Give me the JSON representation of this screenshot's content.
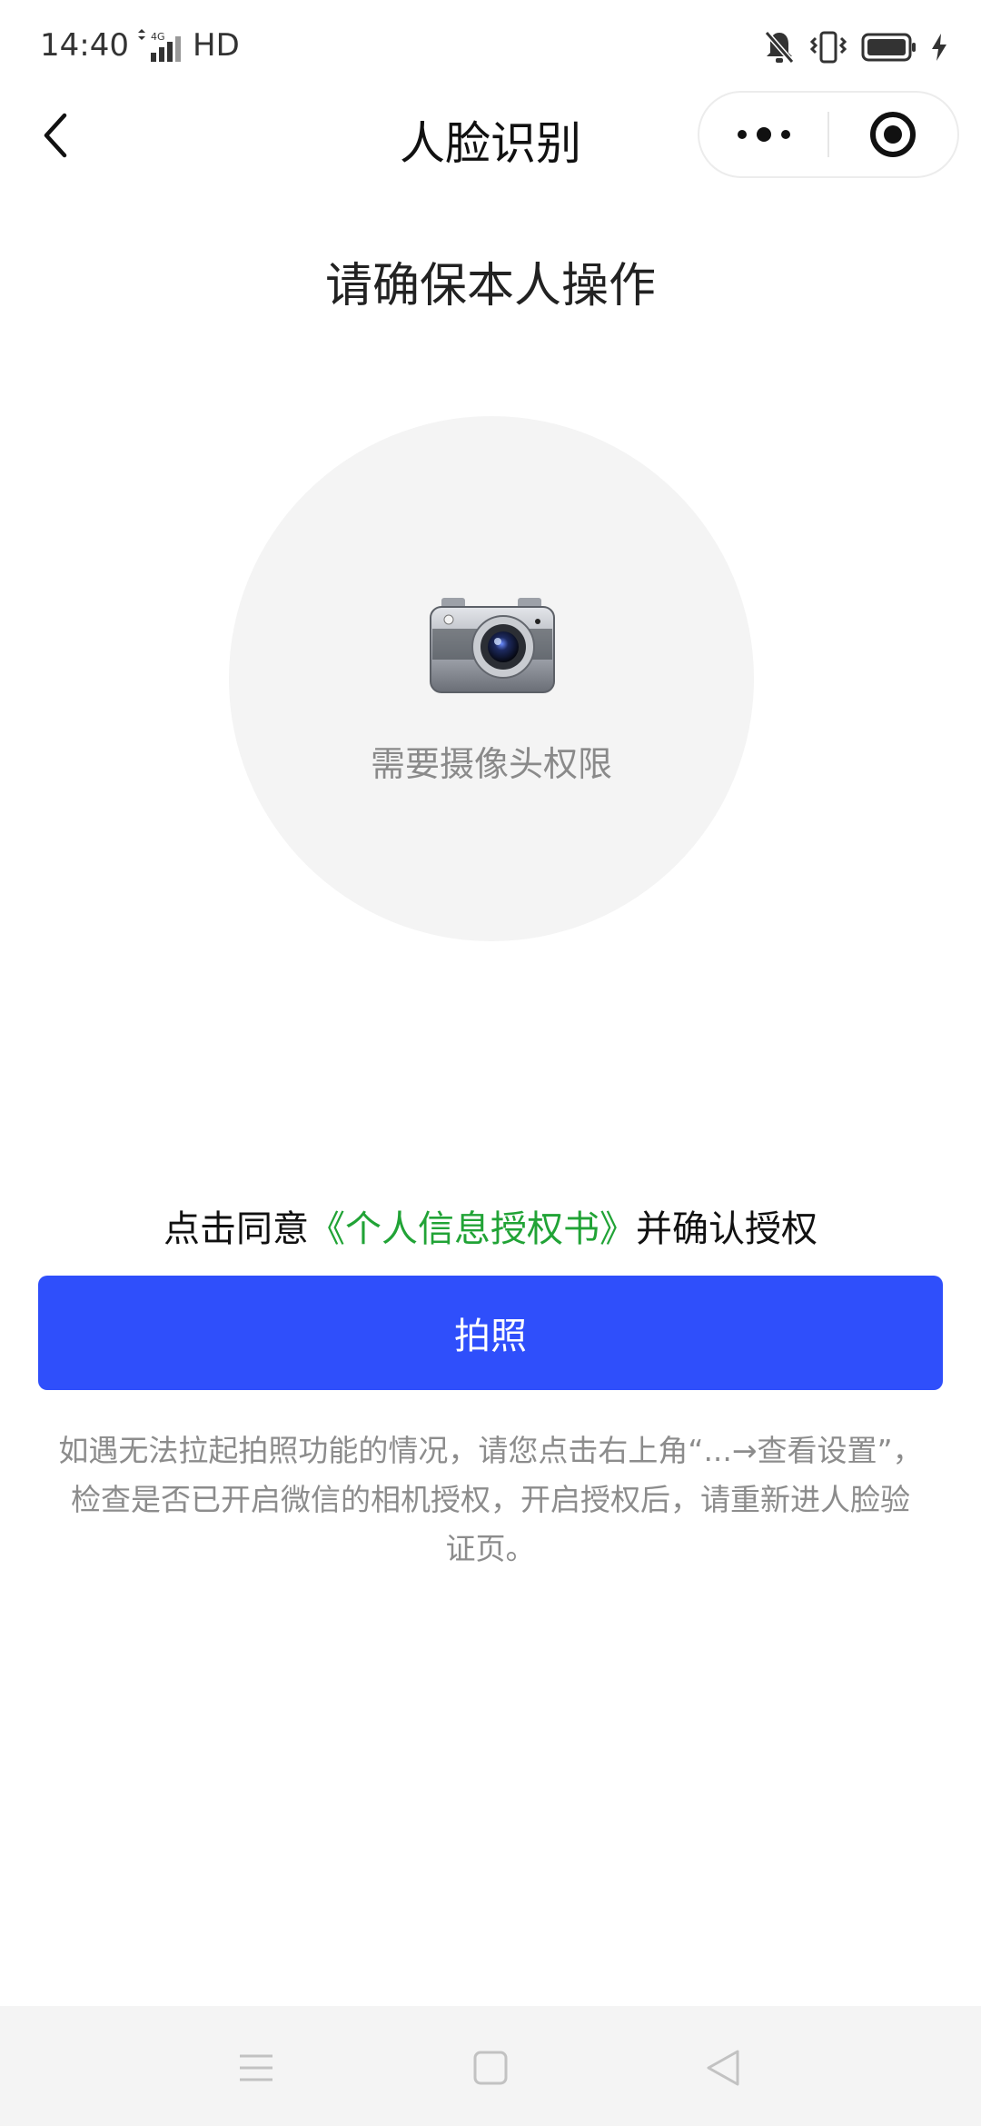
{
  "status_bar": {
    "time": "14:40",
    "network": "HD",
    "icons": [
      "signal-icon",
      "mute-icon",
      "vibrate-icon",
      "battery-icon",
      "charging-icon"
    ]
  },
  "nav": {
    "title": "人脸识别",
    "back_icon": "chevron-left-icon",
    "more_icon": "more-dots-icon",
    "close_icon": "target-close-icon"
  },
  "main": {
    "heading": "请确保本人操作",
    "camera_icon": "camera-icon",
    "camera_prompt": "需要摄像头权限",
    "consent_prefix": "点击同意",
    "consent_link": "《个人信息授权书》",
    "consent_suffix": "并确认授权",
    "photo_button": "拍照",
    "help_text": "如遇无法拉起拍照功能的情况，请您点击右上角“...→查看设置”，检查是否已开启微信的相机授权，开启授权后，请重新进人脸验证页。"
  },
  "colors": {
    "primary_button": "#2f4ffb",
    "link": "#21a336",
    "muted_text": "#8c8c8c",
    "circle_bg": "#f4f4f4"
  },
  "system_nav": {
    "icons": [
      "menu-icon",
      "home-square-icon",
      "back-triangle-icon"
    ]
  }
}
